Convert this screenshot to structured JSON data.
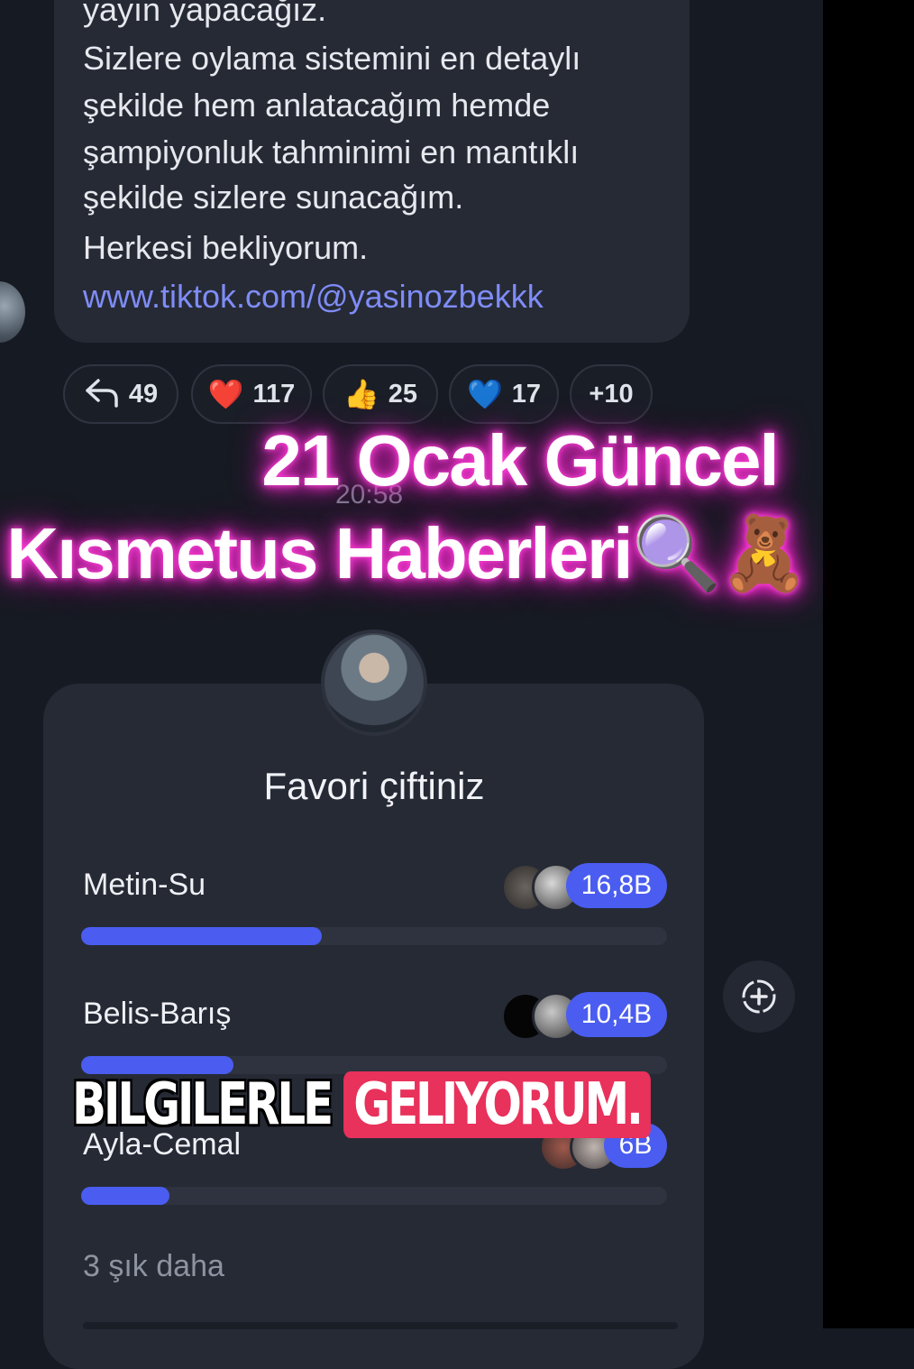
{
  "message": {
    "lines": [
      "yayın yapacağız.",
      "Sizlere oylama sistemini en detaylı",
      "şekilde hem anlatacağım hemde",
      "şampiyonluk tahminimi en mantıklı",
      "şekilde sizlere sunacağım.",
      "Herkesi bekliyorum."
    ],
    "link": "www.tiktok.com/@yasinozbekkk"
  },
  "reactions": [
    {
      "icon": "↰",
      "icon_name": "reply-icon",
      "count": "49"
    },
    {
      "icon": "❤️",
      "icon_name": "red-heart-icon",
      "count": "117"
    },
    {
      "icon": "👍",
      "icon_name": "thumbs-up-icon",
      "count": "25"
    },
    {
      "icon": "💙",
      "icon_name": "blue-heart-icon",
      "count": "17"
    },
    {
      "icon": "",
      "icon_name": "more-reactions",
      "count": "+10"
    }
  ],
  "timestamp": "20:58",
  "overlay": {
    "line1": "21 Ocak Güncel",
    "line2": "Kısmetus Haberleri🔍🧸"
  },
  "poll": {
    "title": "Favori çiftiniz",
    "options": [
      {
        "label": "Metin-Su",
        "count": "16,8B",
        "fraction": 0.41
      },
      {
        "label": "Belis-Barış",
        "count": "10,4B",
        "fraction": 0.26
      },
      {
        "label": "Ayla-Cemal",
        "count": "6B",
        "fraction": 0.15
      }
    ],
    "more": "3 şık daha"
  },
  "caption": {
    "part1": "BILGILERLE",
    "part2": "GELIYORUM."
  },
  "colors": {
    "accent": "#4a5df0",
    "link": "#7f8cf7",
    "glow": "#ff3fd8",
    "caption_highlight": "#e8315b"
  }
}
